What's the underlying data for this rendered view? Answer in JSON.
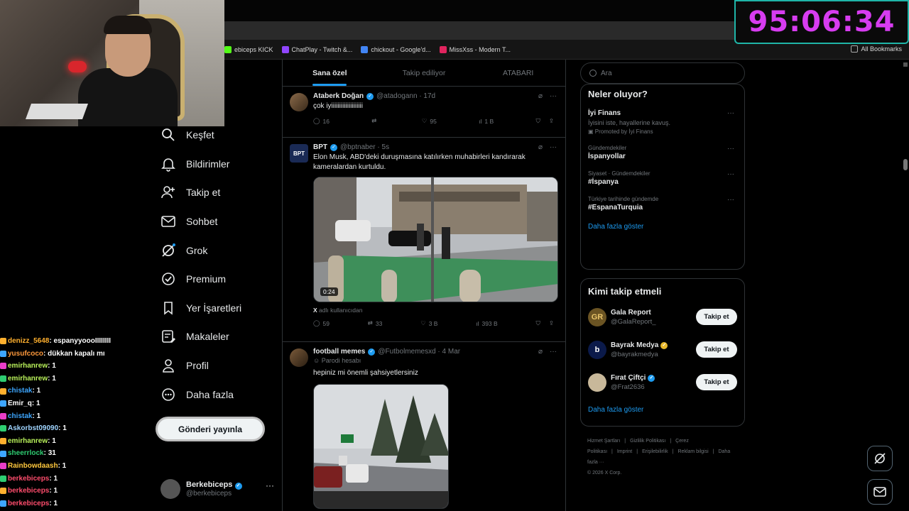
{
  "timer": "95:06:34",
  "bookmarks": [
    {
      "label": "ebiceps KICK",
      "color": "#53fc18"
    },
    {
      "label": "ChatPlay - Twitch &...",
      "color": "#9146ff"
    },
    {
      "label": "chickout - Google'd...",
      "color": "#4285f4"
    },
    {
      "label": "MissXss - Modern T...",
      "color": "#e0245e"
    }
  ],
  "all_bookmarks": "All Bookmarks",
  "chat": [
    {
      "user": "denizz_5648",
      "color": "#ffb02e",
      "msg": ": espanyyoooIIIIIIII"
    },
    {
      "user": "yusufcoco",
      "color": "#ff9a3c",
      "msg": ": dükkan kapalı mı"
    },
    {
      "user": "emirhanrew",
      "color": "#b8f05a",
      "msg": ": 1"
    },
    {
      "user": "emirhanrew",
      "color": "#b8f05a",
      "msg": ": 1"
    },
    {
      "user": "chistak",
      "color": "#3da6ff",
      "msg": ": 1"
    },
    {
      "user": "Emir_q",
      "color": "#ffffff",
      "msg": ": 1"
    },
    {
      "user": "chistak",
      "color": "#3da6ff",
      "msg": ": 1"
    },
    {
      "user": "Askorbst09090",
      "color": "#9fd4ff",
      "msg": ": 1"
    },
    {
      "user": "emirhanrew",
      "color": "#b8f05a",
      "msg": ": 1"
    },
    {
      "user": "sheerrlock",
      "color": "#2ecc71",
      "msg": ": 31"
    },
    {
      "user": "Rainbowdaash",
      "color": "#ffc83d",
      "msg": ": 1"
    },
    {
      "user": "berkebiceps",
      "color": "#ff4d6d",
      "msg": ": 1"
    },
    {
      "user": "berkebiceps",
      "color": "#ff4d6d",
      "msg": ": 1"
    },
    {
      "user": "berkebiceps",
      "color": "#ff4d6d",
      "msg": ": 1"
    }
  ],
  "nav": [
    {
      "icon": "search-icon",
      "label": "Keşfet"
    },
    {
      "icon": "bell-icon",
      "label": "Bildirimler"
    },
    {
      "icon": "add-user-icon",
      "label": "Takip et"
    },
    {
      "icon": "mail-icon",
      "label": "Sohbet"
    },
    {
      "icon": "grok-icon",
      "label": "Grok"
    },
    {
      "icon": "premium-icon",
      "label": "Premium"
    },
    {
      "icon": "bookmark-icon",
      "label": "Yer İşaretleri"
    },
    {
      "icon": "article-icon",
      "label": "Makaleler"
    },
    {
      "icon": "profile-icon",
      "label": "Profil"
    },
    {
      "icon": "more-icon",
      "label": "Daha fazla"
    }
  ],
  "post_button": "Gönderi yayınla",
  "profile": {
    "name": "Berkebiceps",
    "handle": "@berkebiceps",
    "more": "···"
  },
  "tabs": [
    "Sana özel",
    "Takip ediliyor",
    "ATABARI"
  ],
  "tweets": [
    {
      "name": "Ataberk Doğan",
      "meta": "@atadogann · 17d",
      "text": "çok iyiiiiiiiiiiiiiiiiiiii",
      "replies": "16",
      "reposts": "",
      "likes": "95",
      "views": "1 B"
    },
    {
      "name": "BPT",
      "meta": "@bptnaber · 5s",
      "text": "Elon Musk, ABD'deki duruşmasına katılırken muhabirleri kandırarak kameralardan kurtuldu.",
      "duration": "0:24",
      "caption_src": "X",
      "caption": "adlı kullanıcıdan",
      "replies": "59",
      "reposts": "33",
      "likes": "3 B",
      "views": "393 B"
    },
    {
      "name": "football memes",
      "meta": "@Futbolmemesxd · 4 Mar",
      "parody": "Parodi hesabı",
      "text": "hepiniz mi önemli şahsiyetlersiniz"
    }
  ],
  "search_placeholder": "Ara",
  "trends_title": "Neler oluyor?",
  "trends": [
    {
      "cat": "",
      "name": "İyi Finans",
      "sub": "İyisini iste, hayallerine kavuş.",
      "promo": "Promoted by İyi Finans"
    },
    {
      "cat": "Gündemdekiler",
      "name": "İspanyollar"
    },
    {
      "cat": "Siyaset · Gündemdekiler",
      "name": "#İspanya"
    },
    {
      "cat": "Türkiye tarihinde gündemde",
      "name": "#EspanaTurquia"
    }
  ],
  "show_more": "Daha fazla göster",
  "who_title": "Kimi takip etmeli",
  "who": [
    {
      "name": "Gala Report",
      "handle": "@GalaReport_",
      "btn": "Takip et",
      "bg": "#6b5423",
      "fg": "#e8c46a",
      "glyph": "GR"
    },
    {
      "name": "Bayrak Medya",
      "handle": "@bayrakmedya",
      "btn": "Takip et",
      "bg": "#0b1a4a",
      "fg": "#ffffff",
      "glyph": "b"
    },
    {
      "name": "Fırat Çiftçi",
      "handle": "@Frat2636",
      "btn": "Takip et",
      "bg": "#c8b89a",
      "fg": "#4a3a2a",
      "glyph": ""
    }
  ],
  "show_more2": "Daha fazla göster",
  "footer": [
    "Hizmet Şartları",
    "|",
    "Gizlilik Politikası",
    "|",
    "Çerez Politikası",
    "|",
    "Imprint",
    "|",
    "Erişilebilirlik",
    "|",
    "Reklam bilgisi",
    "|",
    "Daha fazla ···",
    "© 2026 X Corp."
  ]
}
